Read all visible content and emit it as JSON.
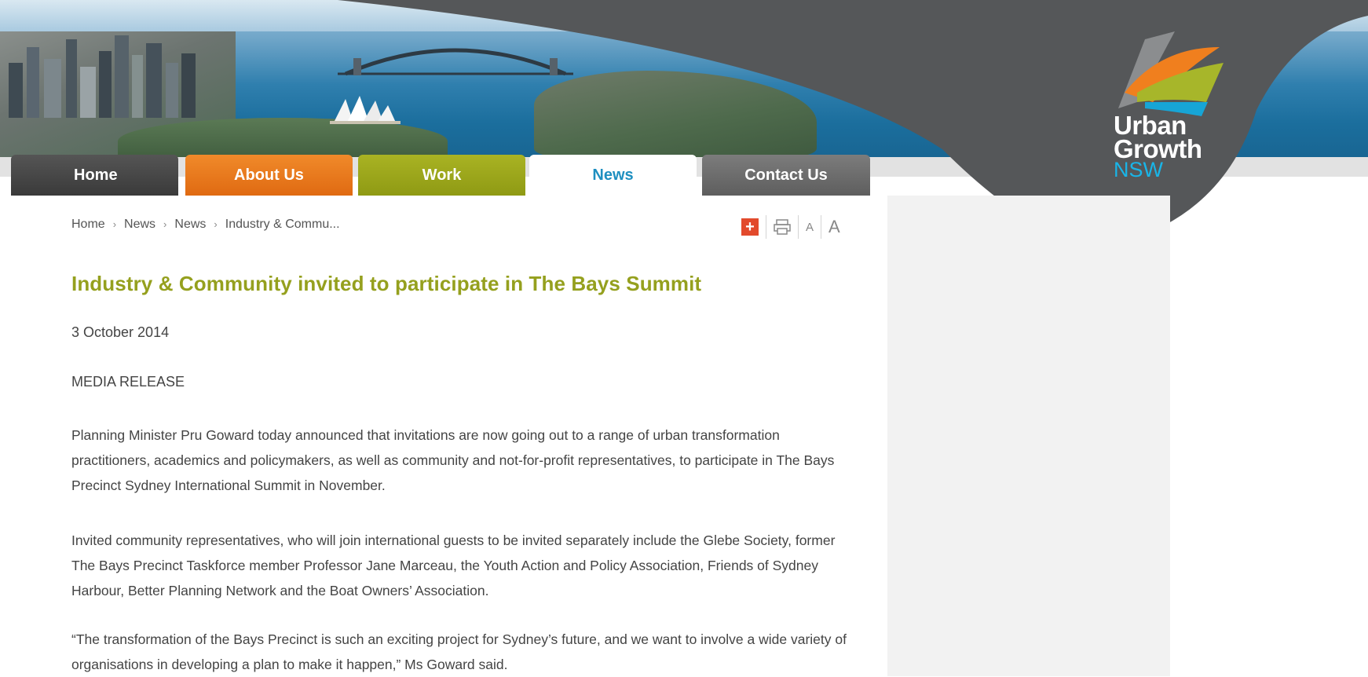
{
  "nav": {
    "tabs": [
      {
        "label": "Home"
      },
      {
        "label": "About Us"
      },
      {
        "label": "Work"
      },
      {
        "label": "News"
      },
      {
        "label": "Contact Us"
      }
    ],
    "active": "News"
  },
  "logo": {
    "line1": "Urban",
    "line2": "Growth",
    "line3": "NSW"
  },
  "breadcrumb": {
    "items": [
      "Home",
      "News",
      "News",
      "Industry & Commu..."
    ]
  },
  "tools": {
    "add_icon": "plus-icon",
    "print_icon": "print-icon",
    "small_text": "A",
    "large_text": "A"
  },
  "article": {
    "title": "Industry & Community invited to participate in The Bays Summit",
    "date": "3 October 2014",
    "kicker": "MEDIA RELEASE",
    "paragraphs": [
      "Planning Minister Pru Goward today announced that invitations are now going out to a range of urban transformation practitioners, academics and policymakers, as well as community and not-for-profit representatives, to participate in The Bays Precinct Sydney International Summit in November.",
      "Invited community representatives, who will join international guests to be invited separately include the Glebe Society, former The Bays Precinct Taskforce member Professor Jane Marceau, the Youth Action and Policy Association, Friends of Sydney Harbour, Better Planning Network and the Boat Owners’ Association.",
      "“The transformation of the Bays Precinct is such an exciting project for Sydney’s future, and we want to involve a wide variety of organisations in developing a plan to make it happen,” Ms Goward said."
    ]
  },
  "colors": {
    "title_green": "#95a01e",
    "news_blue": "#1e8fc0",
    "about_orange": "#e06a12",
    "work_olive": "#8f9a14",
    "swoosh_grey": "#555759",
    "nsw_blue": "#19b5e8"
  }
}
